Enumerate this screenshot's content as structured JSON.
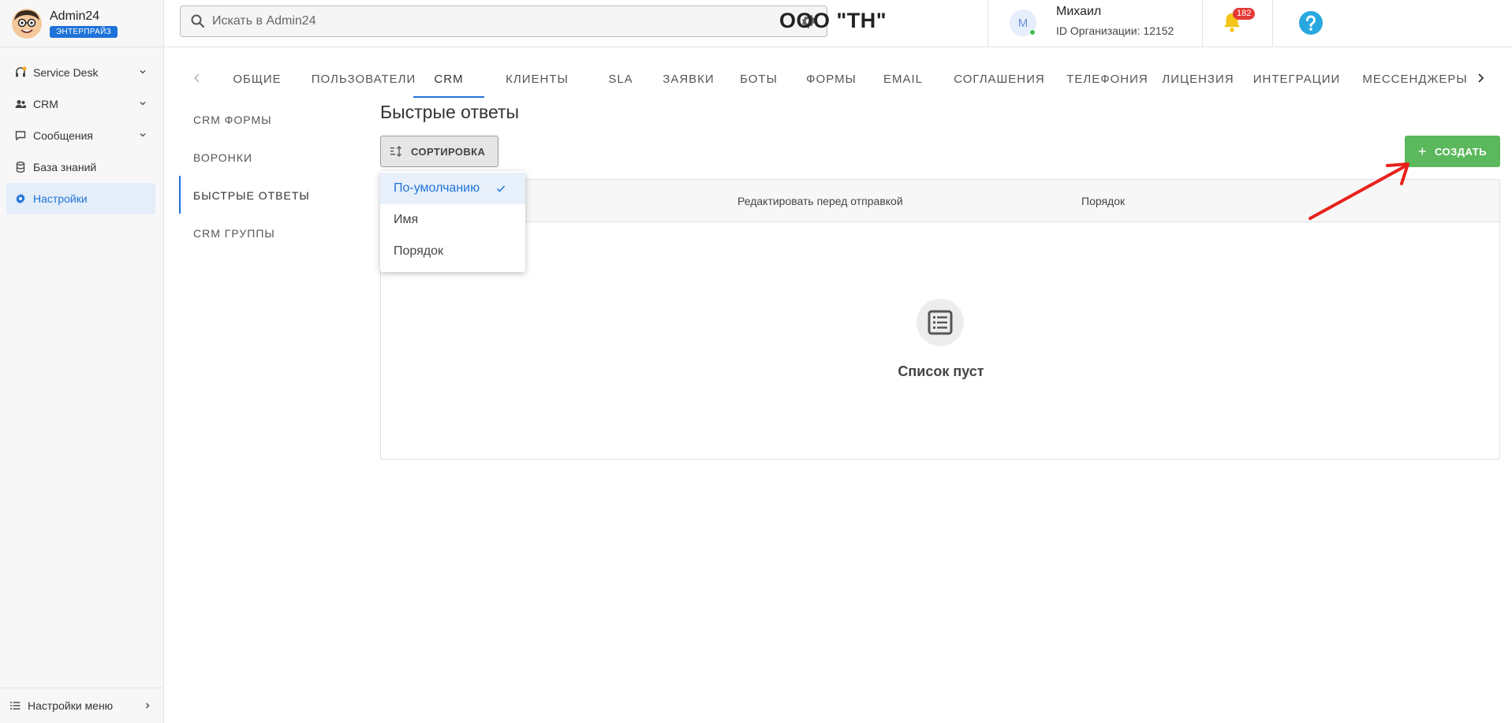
{
  "sidebar": {
    "brand_name": "Admin24",
    "brand_badge": "ЭНТЕРПРАЙЗ",
    "items": [
      {
        "label": "Service Desk",
        "icon": "headset-icon"
      },
      {
        "label": "CRM",
        "icon": "users-icon"
      },
      {
        "label": "Сообщения",
        "icon": "message-icon"
      },
      {
        "label": "База знаний",
        "icon": "database-icon"
      },
      {
        "label": "Настройки",
        "icon": "gear-icon",
        "active": true
      }
    ],
    "bottom_label": "Настройки меню"
  },
  "header": {
    "search_placeholder": "Искать в Admin24",
    "org_title": "ООО \"ТН\"",
    "user_initial": "М",
    "user_name": "Михаил",
    "user_org": "ID Организации: 12152",
    "notifications_count": "182"
  },
  "tabs": [
    {
      "label": "Общие"
    },
    {
      "label": "Пользователи"
    },
    {
      "label": "CRM",
      "active": true
    },
    {
      "label": "Клиенты"
    },
    {
      "label": "SLA"
    },
    {
      "label": "Заявки"
    },
    {
      "label": "Боты"
    },
    {
      "label": "Формы"
    },
    {
      "label": "Email"
    },
    {
      "label": "Соглашения"
    },
    {
      "label": "Телефония"
    },
    {
      "label": "Лицензия"
    },
    {
      "label": "Интеграции"
    },
    {
      "label": "Мессенджеры"
    }
  ],
  "submenu": [
    {
      "label": "CRM формы"
    },
    {
      "label": "Воронки"
    },
    {
      "label": "Быстрые ответы",
      "active": true
    },
    {
      "label": "CRM группы"
    }
  ],
  "content": {
    "title": "Быстрые ответы",
    "sort_label": "СОРТИРОВКА",
    "create_label": "СОЗДАТЬ",
    "columns": [
      "Редактировать перед отправкой",
      "Порядок"
    ],
    "empty_text": "Список пуст"
  },
  "sort_dropdown": {
    "options": [
      "По-умолчанию",
      "Имя",
      "Порядок"
    ],
    "selected": "По-умолчанию"
  },
  "colors": {
    "accent": "#1e73d8",
    "create": "#5cb85c",
    "annotation": "#e8221c"
  }
}
